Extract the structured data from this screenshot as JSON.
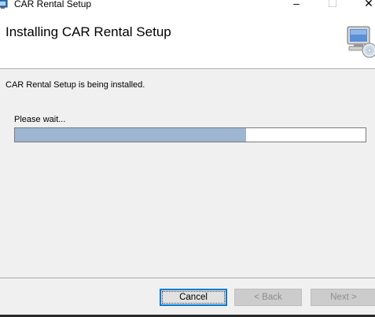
{
  "window": {
    "title": "CAR Rental Setup",
    "controls": {
      "minimize": "–",
      "maximize": "☐",
      "close": "✕"
    }
  },
  "banner": {
    "title": "Installing CAR Rental Setup",
    "icon": "computer-disc-icon"
  },
  "body": {
    "status": "CAR Rental Setup is being installed.",
    "wait": "Please wait...",
    "progress_fraction": 0.66
  },
  "buttons": {
    "cancel": "Cancel",
    "back": "< Back",
    "next": "Next >"
  },
  "colors": {
    "progress_fill": "#9eb6d1",
    "focus_border": "#0078d7"
  }
}
